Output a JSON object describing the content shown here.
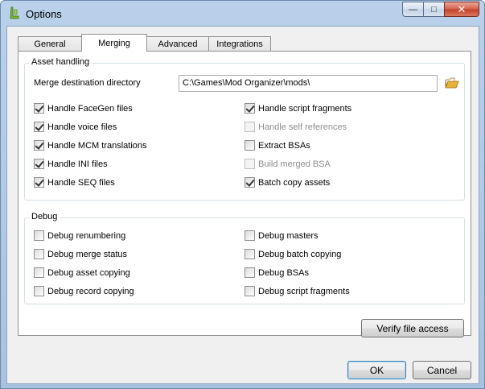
{
  "window": {
    "title": "Options",
    "minimize_glyph": "—",
    "maximize_glyph": "□",
    "close_glyph": "✕"
  },
  "tabs": [
    {
      "label": "General"
    },
    {
      "label": "Merging",
      "active": true
    },
    {
      "label": "Advanced"
    },
    {
      "label": "Integrations"
    }
  ],
  "asset_handling": {
    "title": "Asset handling",
    "merge_dir_label": "Merge destination directory",
    "merge_dir_value": "C:\\Games\\Mod Organizer\\mods\\",
    "left": [
      {
        "label": "Handle FaceGen files",
        "checked": true
      },
      {
        "label": "Handle voice files",
        "checked": true
      },
      {
        "label": "Handle MCM translations",
        "checked": true
      },
      {
        "label": "Handle INI files",
        "checked": true
      },
      {
        "label": "Handle SEQ files",
        "checked": true
      }
    ],
    "right": [
      {
        "label": "Handle script fragments",
        "checked": true
      },
      {
        "label": "Handle self references",
        "checked": false,
        "disabled": true
      },
      {
        "label": "Extract BSAs",
        "checked": false
      },
      {
        "label": "Build merged BSA",
        "checked": false,
        "disabled": true
      },
      {
        "label": "Batch copy assets",
        "checked": true
      }
    ]
  },
  "debug": {
    "title": "Debug",
    "left": [
      {
        "label": "Debug renumbering",
        "checked": false
      },
      {
        "label": "Debug merge status",
        "checked": false
      },
      {
        "label": "Debug asset copying",
        "checked": false
      },
      {
        "label": "Debug record copying",
        "checked": false
      }
    ],
    "right": [
      {
        "label": "Debug masters",
        "checked": false
      },
      {
        "label": "Debug batch copying",
        "checked": false
      },
      {
        "label": "Debug BSAs",
        "checked": false
      },
      {
        "label": "Debug script fragments",
        "checked": false
      }
    ]
  },
  "buttons": {
    "verify": "Verify file access",
    "ok": "OK",
    "cancel": "Cancel"
  },
  "colors": {
    "title_bar": "#b9d1ea",
    "close_button": "#c3442b",
    "folder_icon": "#e8b23a",
    "app_icon": "#7cb82f"
  }
}
